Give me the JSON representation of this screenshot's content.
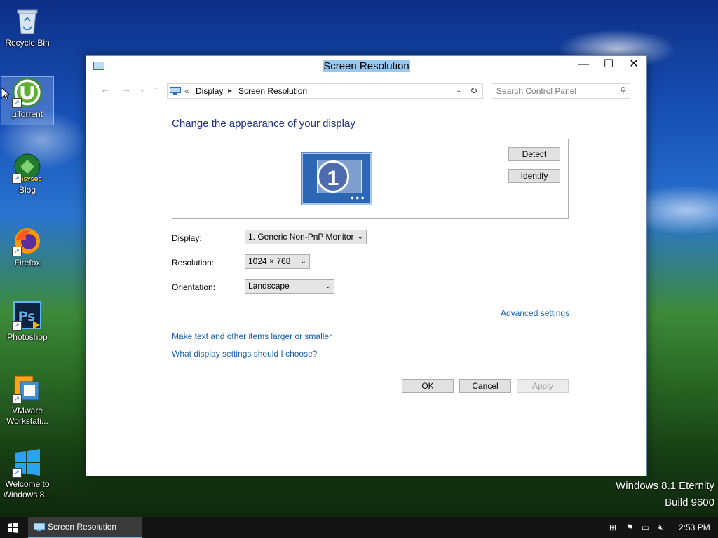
{
  "desktop": {
    "icons": [
      {
        "label": "Recycle Bin",
        "icon": "recycle-bin-icon"
      },
      {
        "label": "µTorrent",
        "icon": "utorrent-icon"
      },
      {
        "label": "Blog",
        "icon": "blog-icon",
        "logo_text": "LABSYSOS"
      },
      {
        "label": "Firefox",
        "icon": "firefox-icon"
      },
      {
        "label": "Photoshop",
        "icon": "photoshop-icon",
        "logo_text": "Ps"
      },
      {
        "label": "VMware Workstati...",
        "icon": "vmware-icon"
      },
      {
        "label": "Welcome to Windows 8...",
        "icon": "windows-logo-icon"
      }
    ],
    "watermark": {
      "line1": "Windows 8.1 Eternity",
      "line2": "Build 9600"
    }
  },
  "window": {
    "title": "Screen Resolution",
    "controls": {
      "minimize": "—",
      "maximize": "☐",
      "close": "✕"
    },
    "breadcrumb": {
      "prefix": "«",
      "items": [
        "Display",
        "Screen Resolution"
      ]
    },
    "search": {
      "placeholder": "Search Control Panel"
    },
    "heading": "Change the appearance of your display",
    "preview": {
      "monitor_number": "1",
      "detect_label": "Detect",
      "identify_label": "Identify"
    },
    "fields": {
      "display": {
        "label": "Display:",
        "value": "1. Generic Non-PnP Monitor"
      },
      "resolution": {
        "label": "Resolution:",
        "value": "1024 × 768"
      },
      "orientation": {
        "label": "Orientation:",
        "value": "Landscape"
      }
    },
    "links": {
      "advanced": "Advanced settings",
      "larger_text": "Make text and other items larger or smaller",
      "what_settings": "What display settings should I choose?"
    },
    "buttons": {
      "ok": "OK",
      "cancel": "Cancel",
      "apply": "Apply"
    }
  },
  "taskbar": {
    "active_item": "Screen Resolution",
    "clock": "2:53 PM"
  },
  "colors": {
    "accent": "#1a61b8",
    "heading": "#1e3287",
    "title_highlight": "#99c9ef"
  }
}
